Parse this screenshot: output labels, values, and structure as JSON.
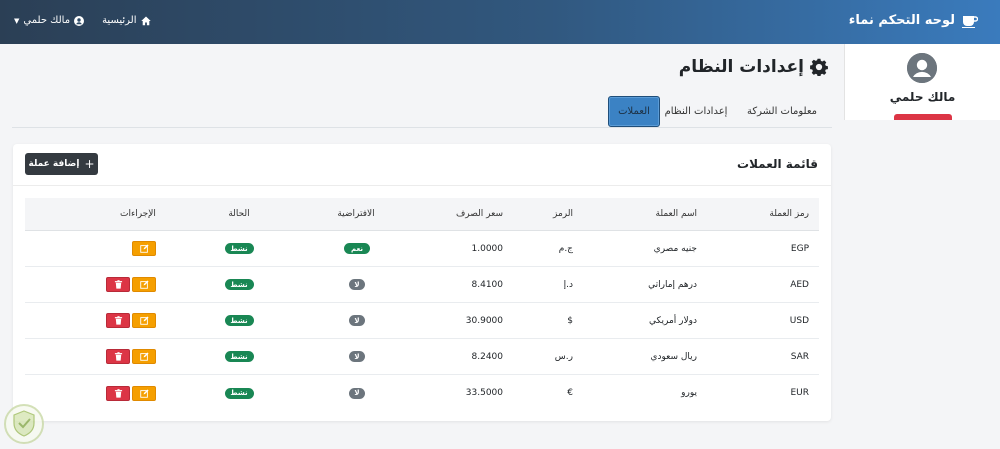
{
  "header": {
    "brand": "لوحه التحكم نماء",
    "home": "الرئيسية",
    "user": "مالك حلمي"
  },
  "sidebar": {
    "user_name": "مالك حلمي"
  },
  "page": {
    "title": "إعدادات النظام"
  },
  "tabs": [
    "معلومات الشركة",
    "إعدادات النظام",
    "العملات"
  ],
  "card": {
    "title": "قائمة العملات",
    "add_button": "إضافة عملة"
  },
  "table": {
    "columns": [
      "رمز العملة",
      "اسم العملة",
      "الرمز",
      "سعر الصرف",
      "الافتراضية",
      "الحالة",
      "الإجراءات"
    ],
    "rows": [
      {
        "code": "EGP",
        "name": "جنيه مصري",
        "symbol": "ج.م",
        "rate": "1.0000",
        "default": "نعم",
        "status": "نشط",
        "deletable": false
      },
      {
        "code": "AED",
        "name": "درهم إماراتي",
        "symbol": "د.إ",
        "rate": "8.4100",
        "default": "لا",
        "status": "نشط",
        "deletable": true
      },
      {
        "code": "USD",
        "name": "دولار أمريكي",
        "symbol": "$",
        "rate": "30.9000",
        "default": "لا",
        "status": "نشط",
        "deletable": true
      },
      {
        "code": "SAR",
        "name": "ريال سعودي",
        "symbol": "ر.س",
        "rate": "8.2400",
        "default": "لا",
        "status": "نشط",
        "deletable": true
      },
      {
        "code": "EUR",
        "name": "يورو",
        "symbol": "€",
        "rate": "33.5000",
        "default": "لا",
        "status": "نشط",
        "deletable": true
      }
    ]
  },
  "colors": {
    "active": "#198754",
    "inactive": "#6c757d",
    "edit": "#f59f00",
    "delete": "#dc3545",
    "dark_button": "#343a40"
  }
}
